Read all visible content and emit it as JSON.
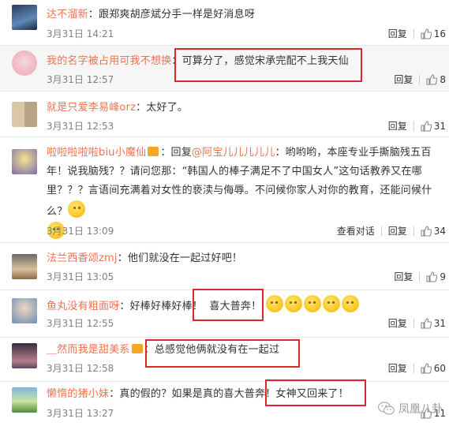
{
  "actions": {
    "reply": "回复",
    "report": "查看对话"
  },
  "comments": [
    {
      "user": "达不溜新",
      "sep": "：",
      "text": "跟郑爽胡彦斌分手一样是好消息呀",
      "time": "3月31日 14:21",
      "likes": "16"
    },
    {
      "user": "我的名字被占用可我不想换",
      "sep": "：",
      "text": "可算分了，感觉宋承完配不上我天仙",
      "time": "3月31日 12:57",
      "likes": "8"
    },
    {
      "user": "就是只爱李易峰orz",
      "sep": "：",
      "text": "太好了。",
      "time": "3月31日 12:53",
      "likes": "31"
    },
    {
      "user": "啦啦啦啦啦biu小魔仙",
      "sep": "",
      "text_a": "：回复",
      "mention": "@阿宝儿儿儿儿儿",
      "text_b": "：哟哟哟，本座专业手撕脑残五百年！说我脑残？？请问您那：“韩国人的棒子满足不了中国女人”这句话教养又在哪里？？？言语间充满着对女性的亵渎与侮辱。不问候你家人对你的教育，还能问候什么？",
      "time": "3月31日 13:09",
      "likes": "34"
    },
    {
      "user": "法兰西香颂zmj",
      "sep": "：",
      "text": "他们就没在一起过好吧！",
      "time": "3月31日 13:05",
      "likes": "9"
    },
    {
      "user": "鱼丸没有粗面呀",
      "sep": "：",
      "text": "好棒好棒好棒！",
      "text_box": "喜大普奔！",
      "time": "3月31日 12:55",
      "likes": "31"
    },
    {
      "user": "＿然而我是甜美系",
      "sep": "",
      "text": "：总感觉他俩就没有在一起过",
      "time": "3月31日 12:58",
      "likes": "60"
    },
    {
      "user": "懒惰的猪小妹",
      "sep": "：",
      "text": "真的假的？如果是真的喜大普奔！",
      "text_box": "女神又回来了！",
      "time": "3月31日 13:27",
      "likes": "11"
    }
  ],
  "watermark": "凤凰八卦",
  "colors": {
    "username": "#eb7350",
    "highlight_box": "#d9292f",
    "text": "#333333",
    "meta": "#808080"
  }
}
